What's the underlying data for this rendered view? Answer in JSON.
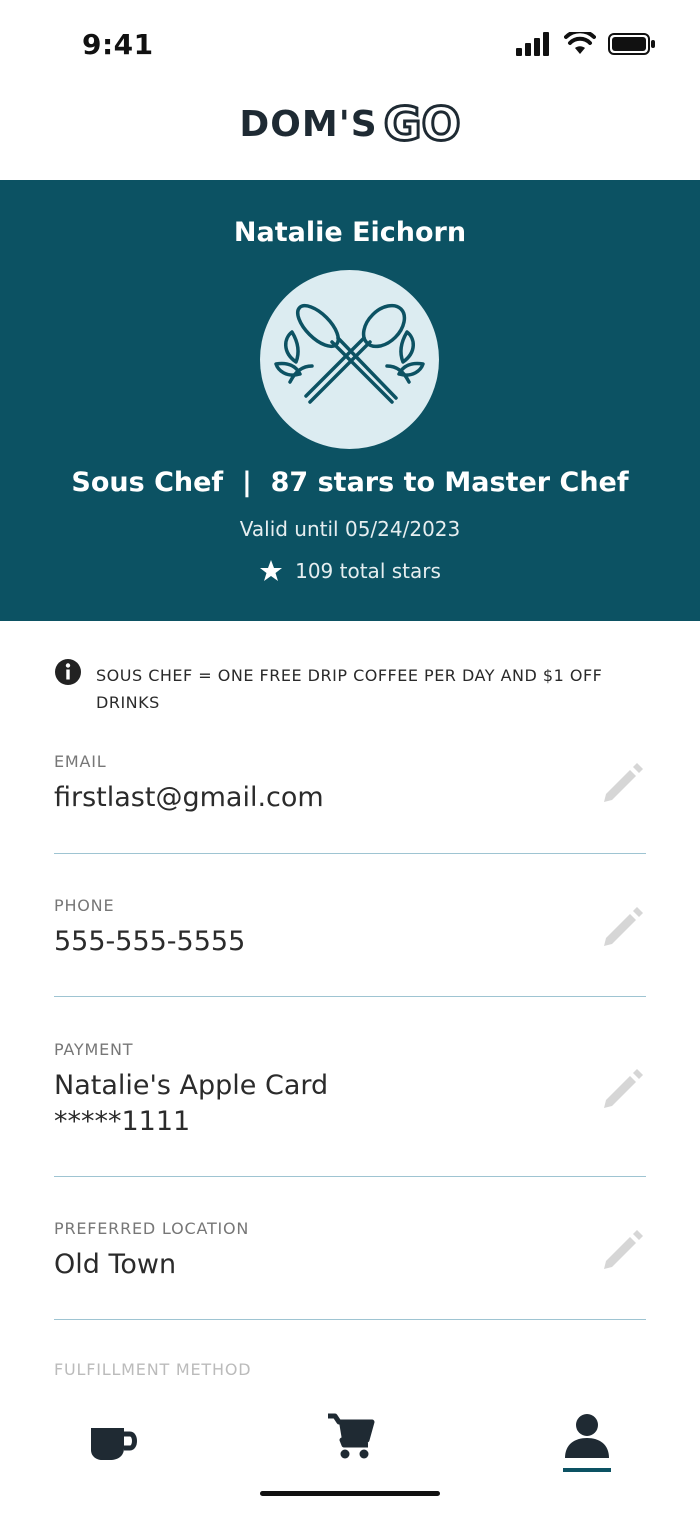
{
  "status": {
    "time": "9:41"
  },
  "brand": {
    "logo_main": "DOM'S",
    "logo_go": "GO"
  },
  "profile": {
    "name": "Natalie Eichorn",
    "level": "Sous Chef  |  87 stars to Master Chef",
    "valid": "Valid until 05/24/2023",
    "total_stars": "109 total stars",
    "badge_icon": "crossed-utensils-icon"
  },
  "info": {
    "text": "SOUS CHEF = ONE FREE DRIP COFFEE PER DAY AND $1 OFF DRINKS"
  },
  "fields": {
    "email": {
      "label": "EMAIL",
      "value": "firstlast@gmail.com"
    },
    "phone": {
      "label": "PHONE",
      "value": "555-555-5555"
    },
    "payment": {
      "label": "PAYMENT",
      "value": "Natalie's Apple Card",
      "value2": "*****1111"
    },
    "location": {
      "label": "PREFERRED LOCATION",
      "value": "Old Town"
    },
    "fulfillment": {
      "label": "FULFILLMENT METHOD"
    }
  },
  "tabs": [
    "coffee-icon",
    "cart-icon",
    "profile-icon"
  ],
  "colors": {
    "primary": "#0c5263",
    "badge_bg": "#dcecf1",
    "divider": "#9ec4d2",
    "icon_gray": "#d6d6d6"
  }
}
